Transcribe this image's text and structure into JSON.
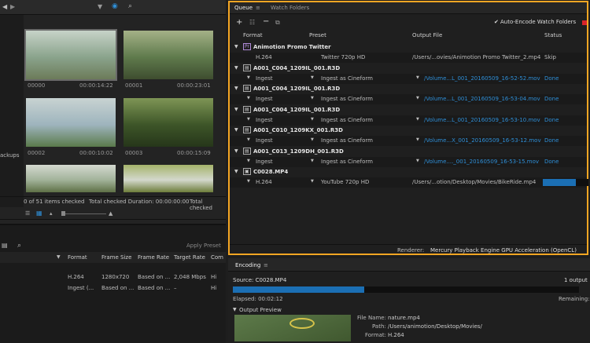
{
  "left": {
    "thumbs": [
      {
        "name": "00000",
        "dur": "00:00:14:22",
        "colors": [
          "#8aa38c",
          "#c7d3c8",
          "#6c7b59"
        ]
      },
      {
        "name": "00001",
        "dur": "00:00:23:01",
        "colors": [
          "#5f7a4c",
          "#a4b187",
          "#3e4d2f"
        ]
      },
      {
        "name": "00002",
        "dur": "00:00:10:02",
        "colors": [
          "#9eb4bd",
          "#c8d3d2",
          "#5a7a4b"
        ]
      },
      {
        "name": "00003",
        "dur": "00:00:15:09",
        "colors": [
          "#3d5528",
          "#7e9555",
          "#26361a"
        ]
      },
      {
        "name": "",
        "dur": "",
        "colors": [
          "#a2b39a",
          "#d4d9d0",
          "#5e7046"
        ]
      },
      {
        "name": "",
        "dur": "",
        "colors": [
          "#d3d8cc",
          "#a5b36a",
          "#6d7d3a"
        ]
      }
    ],
    "side_label": "ackups",
    "status": {
      "checked": "0 of 51 items checked",
      "duration": "Total checked Duration: 00:00:00:00",
      "more": "Total checked"
    },
    "apply_preset": "Apply Preset",
    "columns": [
      "Format",
      "Frame Size",
      "Frame Rate",
      "Target Rate",
      "Com"
    ],
    "rows": [
      [
        "H.264",
        "1280x720",
        "Based on ...",
        "2,048 Mbps",
        "Hi"
      ],
      [
        "Ingest (...",
        "Based on ...",
        "Based on ...",
        "–",
        "Hi"
      ]
    ]
  },
  "queue": {
    "tabs": {
      "queue": "Queue",
      "watch": "Watch Folders"
    },
    "auto_encode": "Auto-Encode Watch Folders",
    "columns": {
      "format": "Format",
      "preset": "Preset",
      "output": "Output File",
      "status": "Status"
    },
    "items": [
      {
        "title": "Animotion Promo Twitter",
        "icon": "premiere-icon",
        "sub": {
          "format": "H.264",
          "preset": "Twitter 720p HD",
          "output": "/Users/...ovies/Animotion Promo Twitter_2.mp4",
          "status": "Skip",
          "blue": false,
          "dd": false
        }
      },
      {
        "title": "A001_C004_1209IL_001.R3D",
        "icon": "film-icon",
        "sub": {
          "format": "Ingest",
          "preset": "Ingest as Cineform",
          "output": "/Volume...L_001_20160509_16-52-52.mov",
          "status": "Done",
          "blue": true,
          "dd": true
        }
      },
      {
        "title": "A001_C004_1209IL_001.R3D",
        "icon": "film-icon",
        "sub": {
          "format": "Ingest",
          "preset": "Ingest as Cineform",
          "output": "/Volume...L_001_20160509_16-53-04.mov",
          "status": "Done",
          "blue": true,
          "dd": true
        }
      },
      {
        "title": "A001_C004_1209IL_001.R3D",
        "icon": "film-icon",
        "sub": {
          "format": "Ingest",
          "preset": "Ingest as Cineform",
          "output": "/Volume...L_001_20160509_16-53-10.mov",
          "status": "Done",
          "blue": true,
          "dd": true
        }
      },
      {
        "title": "A001_C010_1209KX_001.R3D",
        "icon": "film-icon",
        "sub": {
          "format": "Ingest",
          "preset": "Ingest as Cineform",
          "output": "/Volume...X_001_20160509_16-53-12.mov",
          "status": "Done",
          "blue": true,
          "dd": true
        }
      },
      {
        "title": "A001_C013_1209DH_001.R3D",
        "icon": "film-icon",
        "sub": {
          "format": "Ingest",
          "preset": "Ingest as Cineform",
          "output": "/Volume...._001_20160509_16-53-15.mov",
          "status": "Done",
          "blue": true,
          "dd": true
        }
      },
      {
        "title": "C0028.MP4",
        "icon": "video-file-icon",
        "sub": {
          "format": "H.264",
          "preset": "YouTube 720p HD",
          "output": "/Users/...otion/Desktop/Movies/BikeRide.mp4",
          "status": "",
          "blue": false,
          "dd": true,
          "progress": 0.72
        }
      }
    ],
    "renderer_label": "Renderer:",
    "renderer_value": "Mercury Playback Engine GPU Acceleration (OpenCL)"
  },
  "encoding": {
    "title": "Encoding",
    "source": "Source: C0028.MP4",
    "outputs": "1 output",
    "progress": 0.38,
    "elapsed": "Elapsed: 00:02:12",
    "remaining": "Remaining:",
    "preview_label": "Output Preview",
    "file_name_label": "File Name:",
    "file_name": "nature.mp4",
    "path_label": "Path:",
    "path": "/Users/animotion/Desktop/Movies/",
    "format_label": "Format:",
    "format": "H.264"
  }
}
